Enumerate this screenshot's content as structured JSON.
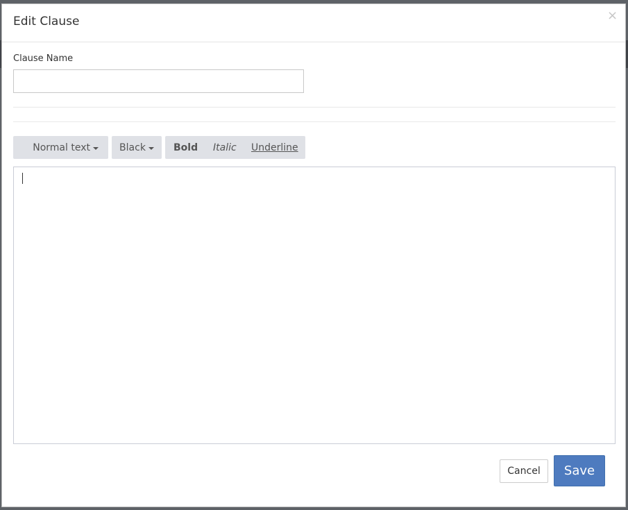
{
  "modal": {
    "title": "Edit Clause",
    "close_symbol": "×"
  },
  "form": {
    "clause_name_label": "Clause Name",
    "clause_name_value": "",
    "clause_name_placeholder": ""
  },
  "toolbar": {
    "text_style": "Normal text",
    "text_color": "Black",
    "bold_label": "Bold",
    "italic_label": "Italic",
    "underline_label": "Underline"
  },
  "editor": {
    "content": ""
  },
  "footer": {
    "cancel_label": "Cancel",
    "save_label": "Save"
  },
  "colors": {
    "primary": "#4e7bbf",
    "toolbar_bg": "#dfe1e6",
    "overlay": "#5e6267"
  },
  "icons": {
    "close": "close-icon",
    "dropdown": "caret-down-icon"
  }
}
